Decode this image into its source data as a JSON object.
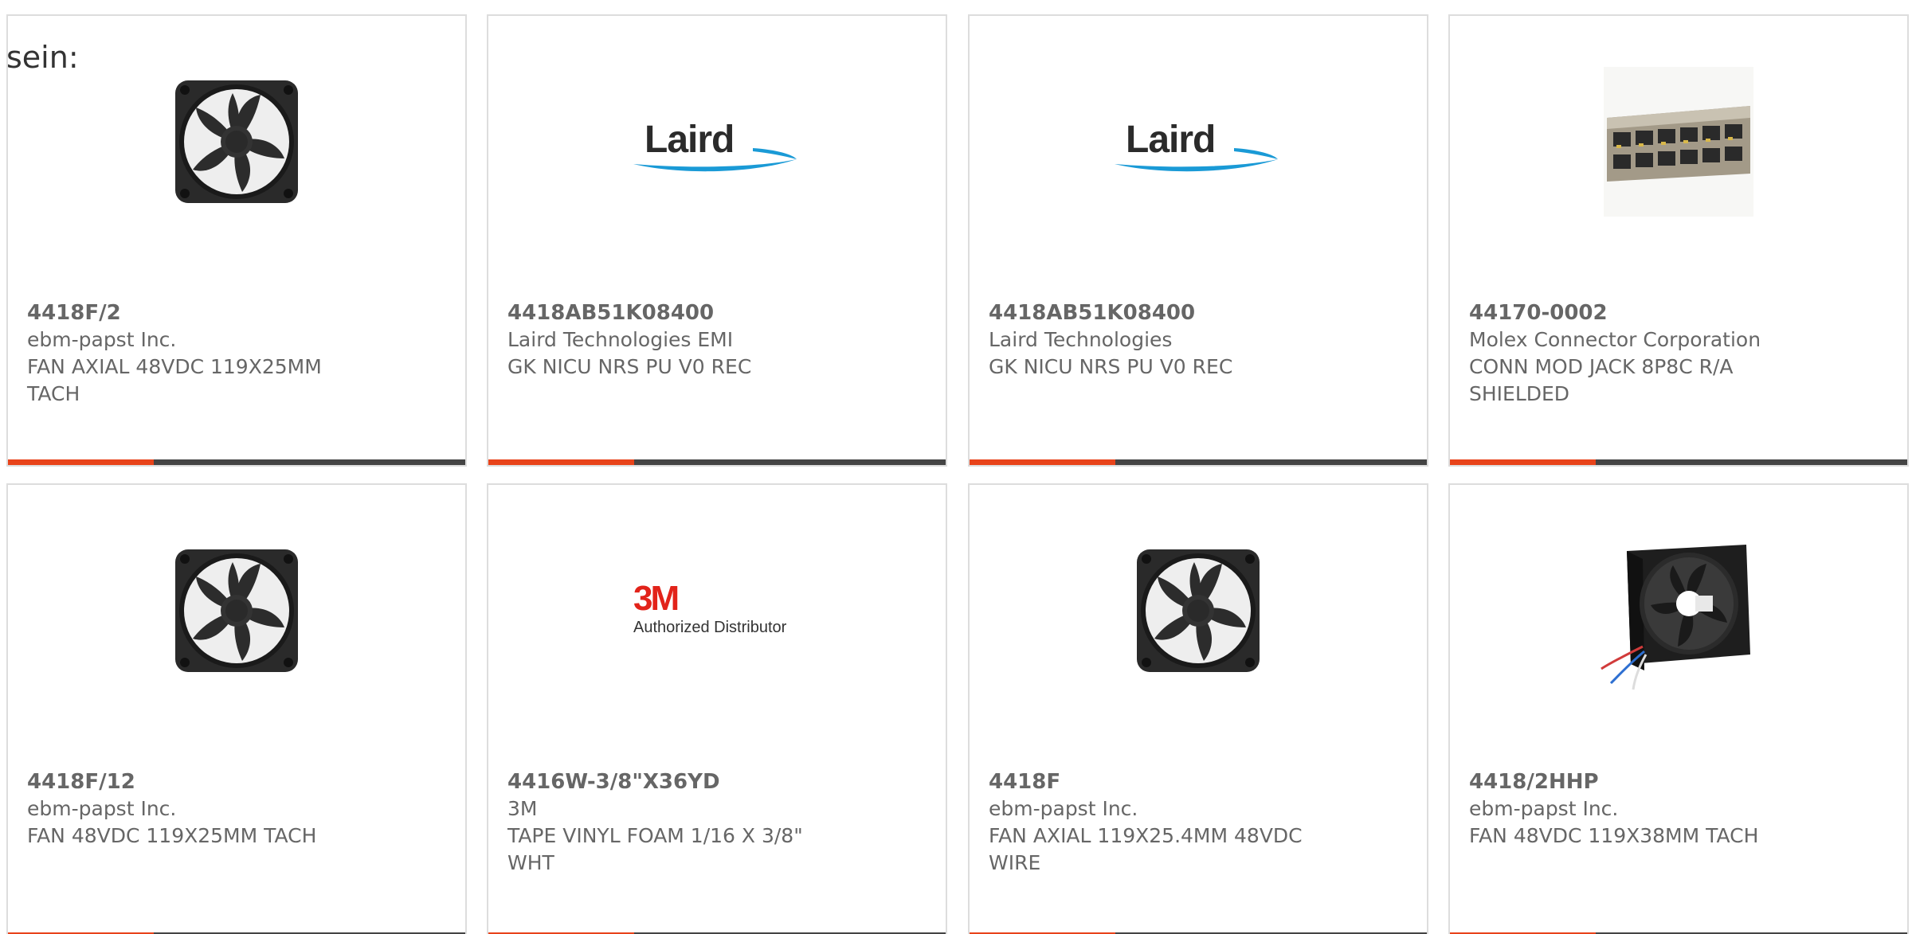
{
  "intro_text": "sein:",
  "colors": {
    "accent": "#e8431a",
    "bar": "#444444",
    "text": "#666666"
  },
  "cards": [
    {
      "part_number": "4418F/2",
      "manufacturer": "ebm-papst Inc.",
      "description": "FAN AXIAL 48VDC 119X25MM TACH",
      "image": "fan-image"
    },
    {
      "part_number": "4418AB51K08400",
      "manufacturer": "Laird Technologies EMI",
      "description": "GK NICU NRS PU V0 REC",
      "image": "laird-logo",
      "logo_text": "Laird"
    },
    {
      "part_number": "4418AB51K08400",
      "manufacturer": "Laird Technologies",
      "description": "GK NICU NRS PU V0 REC",
      "image": "laird-logo",
      "logo_text": "Laird"
    },
    {
      "part_number": "44170-0002",
      "manufacturer": "Molex Connector Corporation",
      "description": "CONN MOD JACK 8P8C R/A SHIELDED",
      "image": "connector-image"
    },
    {
      "part_number": "4418F/12",
      "manufacturer": "ebm-papst Inc.",
      "description": "FAN 48VDC 119X25MM TACH",
      "image": "fan-image"
    },
    {
      "part_number": "4416W-3/8\"X36YD",
      "manufacturer": "3M",
      "description": "TAPE VINYL FOAM 1/16 X 3/8\" WHT",
      "image": "3m-logo",
      "logo_text": "3M",
      "logo_subtext": "Authorized Distributor"
    },
    {
      "part_number": "4418F",
      "manufacturer": "ebm-papst Inc.",
      "description": "FAN AXIAL 119X25.4MM 48VDC WIRE",
      "image": "fan-image"
    },
    {
      "part_number": "4418/2HHP",
      "manufacturer": "ebm-papst Inc.",
      "description": "FAN 48VDC 119X38MM TACH",
      "image": "fan-wired-image"
    }
  ]
}
